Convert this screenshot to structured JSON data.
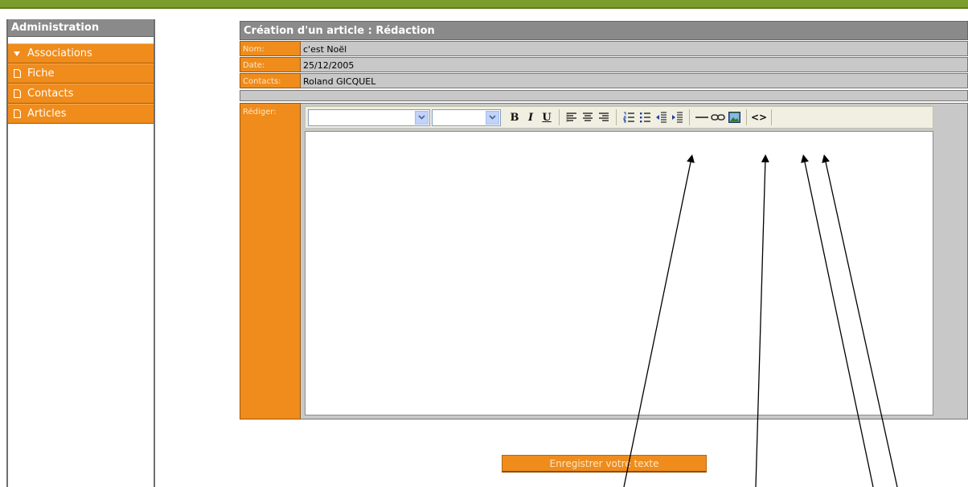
{
  "sidebar": {
    "header": "Administration",
    "items": [
      {
        "label": "Associations",
        "icon": "triangle-down-icon"
      },
      {
        "label": "Fiche",
        "icon": "document-icon"
      },
      {
        "label": "Contacts",
        "icon": "document-icon"
      },
      {
        "label": "Articles",
        "icon": "document-icon"
      }
    ]
  },
  "panel": {
    "title": "Création d'un article : Rédaction",
    "fields": [
      {
        "label": "Nom:",
        "value": "c'est Noël"
      },
      {
        "label": "Date:",
        "value": "25/12/2005"
      },
      {
        "label": "Contacts:",
        "value": "Roland GICQUEL"
      }
    ],
    "editor_label": "Rédiger:",
    "toolbar": {
      "font_select": "",
      "size_select": "",
      "bold": "B",
      "italic": "I",
      "underline": "U",
      "source": "<>"
    }
  },
  "save_button": "Enregistrer votre texte",
  "colors": {
    "accent": "#ef8c1c",
    "header_gray": "#8a8a8a",
    "field_gray": "#c8c8c8",
    "banner_green": "#7a9c2c"
  }
}
